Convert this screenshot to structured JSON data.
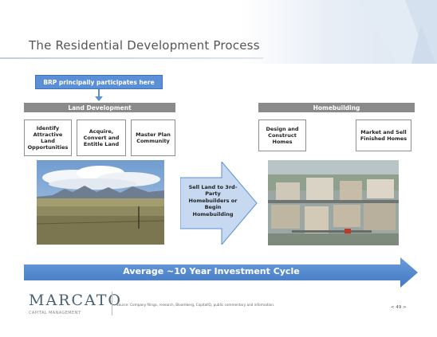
{
  "slide": {
    "title": "The Residential Development Process"
  },
  "callout": {
    "label": "BRP principally participates here"
  },
  "land_development": {
    "header": "Land Development",
    "steps": [
      "Identify Attractive Land Opportunities",
      "Acquire, Convert and Entitle Land",
      "Master Plan Community"
    ]
  },
  "homebuilding": {
    "header": "Homebuilding",
    "steps": [
      "Design and Construct Homes",
      "Market and Sell Finished Homes"
    ]
  },
  "transition": {
    "text": "Sell Land to 3rd-Party Homebuilders or Begin Homebuilding"
  },
  "cycle": {
    "label": "Average ~10 Year Investment Cycle"
  },
  "footer": {
    "logo": "MARCATO",
    "logo_sub": "CAPITAL MANAGEMENT",
    "source": "Source: Company filings, research, Bloomberg, CapitalIQ, public commentary and information.",
    "page": "< 49 >"
  },
  "colors": {
    "accent_blue": "#5b8fd6",
    "bar_gray": "#8a8a8a",
    "arrow_light": "#c7d9f0"
  }
}
